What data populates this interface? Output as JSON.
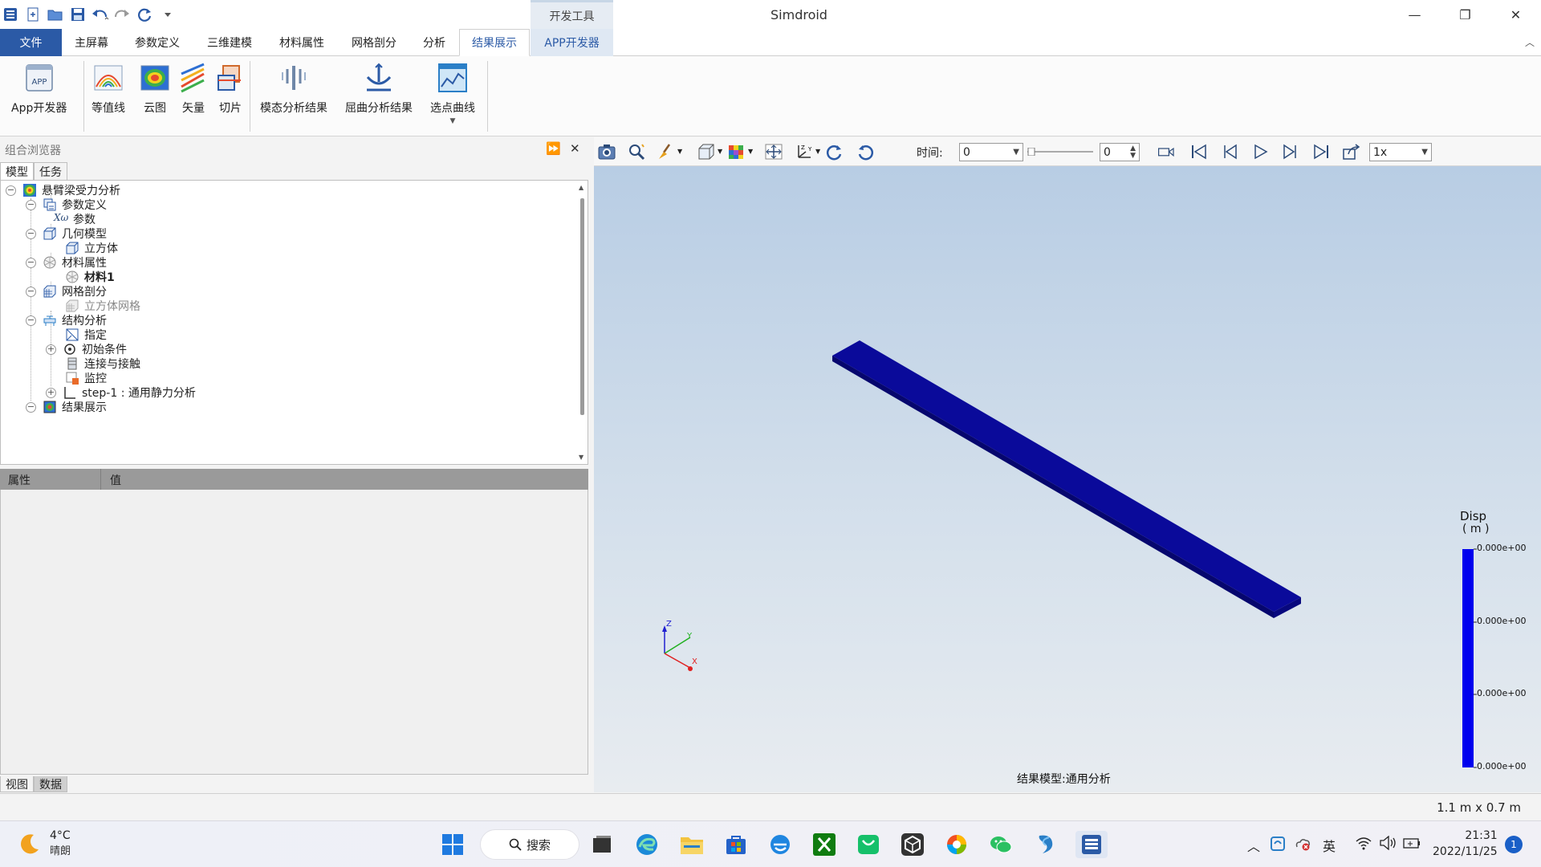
{
  "window": {
    "title": "Simdroid",
    "contextual_tab": "开发工具",
    "minimize": "—",
    "restore": "❐",
    "close": "✕"
  },
  "tabs": [
    "文件",
    "主屏幕",
    "参数定义",
    "三维建模",
    "材料属性",
    "网格剖分",
    "分析",
    "结果展示",
    "APP开发器"
  ],
  "active_tab": "结果展示",
  "ribbon": {
    "app_dev": "App开发器",
    "app_icon_text": "APP",
    "contour": "等值线",
    "cloud": "云图",
    "vector": "矢量",
    "slice": "切片",
    "modal": "模态分析结果",
    "buckling": "屈曲分析结果",
    "point_curve": "选点曲线"
  },
  "browser": {
    "title": "组合浏览器",
    "tab_model": "模型",
    "tab_task": "任务",
    "tree": {
      "root": "悬臂梁受力分析",
      "param_def": "参数定义",
      "param_icon": "Xω",
      "param": "参数",
      "geometry": "几何模型",
      "cube": "立方体",
      "material_props": "材料属性",
      "material1": "材料1",
      "mesh": "网格剖分",
      "cube_mesh": "立方体网格",
      "structural": "结构分析",
      "assign": "指定",
      "initial": "初始条件",
      "connection": "连接与接触",
      "monitor": "监控",
      "step": "step-1 : 通用静力分析",
      "results": "结果展示"
    }
  },
  "properties": {
    "col_prop": "属性",
    "col_value": "值"
  },
  "bottom_tabs": [
    "视图",
    "数据"
  ],
  "viewport_toolbar": {
    "time_label": "时间:",
    "time_value": "0",
    "step_value": "0",
    "speed": "1x"
  },
  "viewport": {
    "legend_title": "Disp",
    "legend_unit": "( m )",
    "legend_values": [
      "0.000e+00",
      "0.000e+00",
      "0.000e+00",
      "0.000e+00"
    ],
    "legend_color": "#0000ee",
    "beam_color": "#0a0a9a",
    "model_label": "结果模型:通用分析",
    "axis_z": "Z",
    "axis_y": "Y",
    "axis_x": "X"
  },
  "status": {
    "dimensions": "1.1 m x 0.7 m"
  },
  "taskbar": {
    "temp": "4°C",
    "weather": "晴朗",
    "search": "搜索",
    "ime": "英",
    "time": "21:31",
    "date": "2022/11/25",
    "notifications": "1"
  }
}
